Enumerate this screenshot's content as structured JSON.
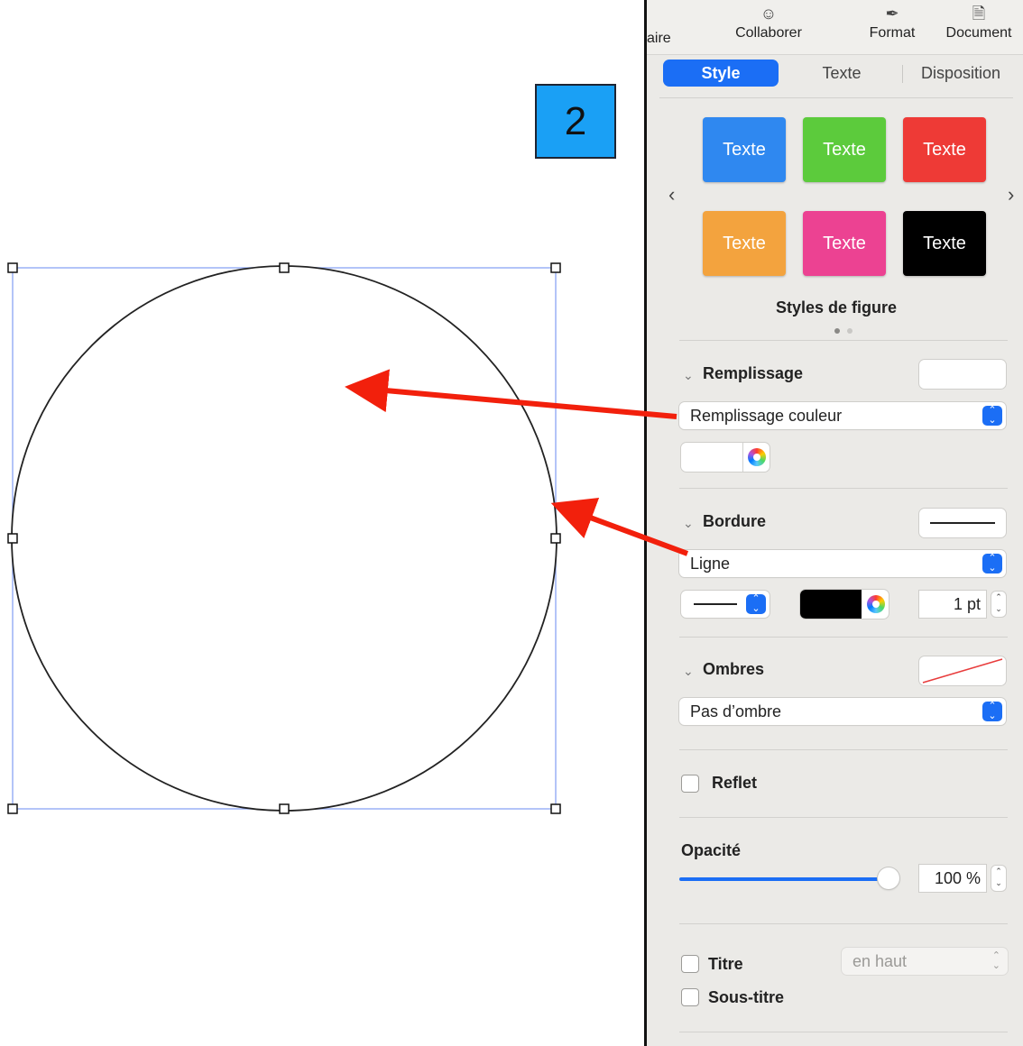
{
  "annotation": {
    "step_number": "2"
  },
  "toolbar": {
    "cut_item_label": "aire",
    "collaborate_label": "Collaborer",
    "format_label": "Format",
    "document_label": "Document"
  },
  "tabs": {
    "style": "Style",
    "text": "Texte",
    "layout": "Disposition"
  },
  "shape_styles": {
    "caption": "Styles de figure",
    "items": [
      {
        "label": "Texte",
        "color": "#2f88f0"
      },
      {
        "label": "Texte",
        "color": "#5ccb3c"
      },
      {
        "label": "Texte",
        "color": "#ee3a36"
      },
      {
        "label": "Texte",
        "color": "#f3a33e"
      },
      {
        "label": "Texte",
        "color": "#ec4292"
      },
      {
        "label": "Texte",
        "color": "#000000"
      }
    ],
    "page_count": 2,
    "current_page": 1
  },
  "fill": {
    "title": "Remplissage",
    "type": "Remplissage couleur",
    "color": "#ffffff"
  },
  "border": {
    "title": "Bordure",
    "type": "Ligne",
    "color": "#000000",
    "width": "1 pt"
  },
  "shadow": {
    "title": "Ombres",
    "type": "Pas d’ombre"
  },
  "reflection": {
    "label": "Reflet",
    "checked": false
  },
  "opacity": {
    "label": "Opacité",
    "value": "100 %",
    "fraction": 1.0
  },
  "caption_options": {
    "title_label": "Titre",
    "title_checked": false,
    "position": "en haut",
    "subtitle_label": "Sous-titre",
    "subtitle_checked": false
  },
  "colors": {
    "accent": "#1b6ef5",
    "arrow": "#f2200c",
    "selection": "#9ab0f5",
    "badge": "#1aa0f5"
  }
}
